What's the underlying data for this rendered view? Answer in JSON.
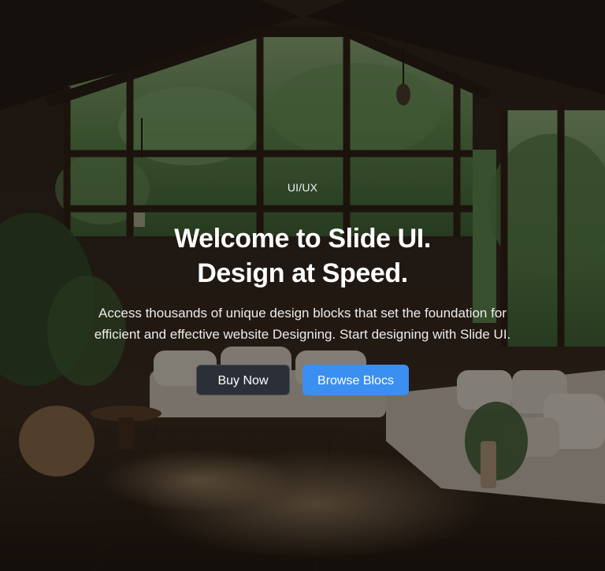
{
  "hero": {
    "eyebrow": "UI/UX",
    "title_line_1": "Welcome to Slide UI.",
    "title_line_2": "Design at Speed.",
    "subtitle_line_1": "Access thousands of unique design blocks that set the foundation for",
    "subtitle_line_2": "efficient and effective website Designing. Start designing with Slide UI.",
    "background_image": "cozy-wooden-living-room-photo"
  },
  "buttons": {
    "buy_now": "Buy Now",
    "browse_blocs": "Browse Blocs"
  },
  "colors": {
    "primary_button": "#3b8ff0",
    "secondary_button": "#2b3038",
    "overlay": "#0a0908",
    "text": "#ffffff"
  }
}
